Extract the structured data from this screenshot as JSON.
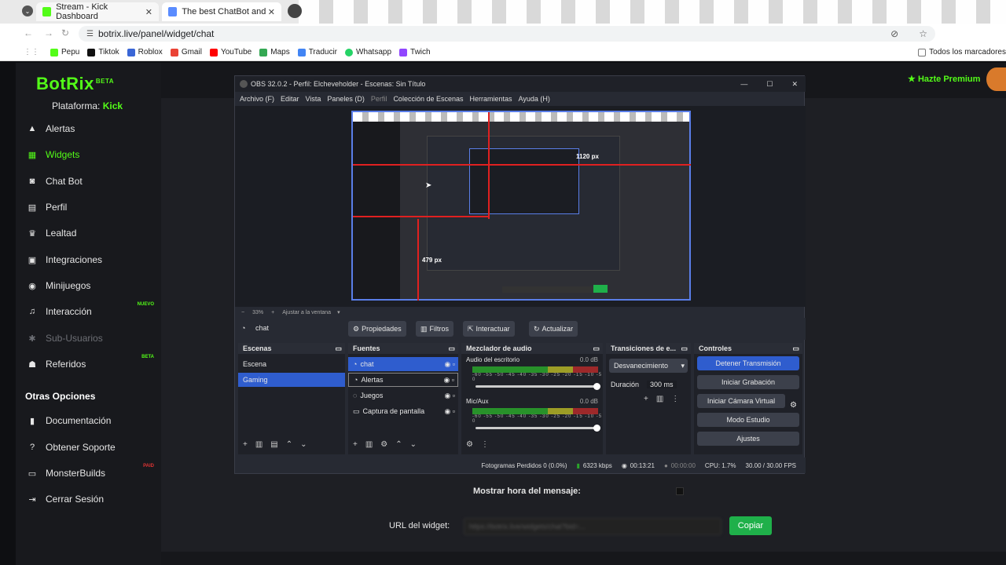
{
  "browser": {
    "tabs": [
      {
        "label": "Stream - Kick Dashboard",
        "color": "#53fc18"
      },
      {
        "label": "The best ChatBot and Widgets",
        "color": "#5a8cff"
      }
    ],
    "url": "botrix.live/panel/widget/chat",
    "bookmarks": [
      "Pepu",
      "Tiktok",
      "Roblox",
      "Gmail",
      "YouTube",
      "Maps",
      "Traducir",
      "Whatsapp",
      "Twich"
    ],
    "bookmarks_right": "Todos los marcadores"
  },
  "app": {
    "logo": "BotRix",
    "logo_badge": "BETA",
    "platform_label": "Plataforma:",
    "platform_value": "Kick",
    "premium": "Hazte Premium",
    "accent": "#53fc18"
  },
  "sidebar": {
    "items": [
      {
        "label": "Alertas",
        "icon": "warning-icon"
      },
      {
        "label": "Widgets",
        "icon": "grid-icon",
        "active": true
      },
      {
        "label": "Chat Bot",
        "icon": "robot-icon"
      },
      {
        "label": "Perfil",
        "icon": "id-card-icon"
      },
      {
        "label": "Lealtad",
        "icon": "trophy-icon"
      },
      {
        "label": "Integraciones",
        "icon": "plug-icon"
      },
      {
        "label": "Minijuegos",
        "icon": "gamepad-icon"
      },
      {
        "label": "Interacción",
        "icon": "music-icon",
        "badge": "NUEVO"
      },
      {
        "label": "Sub-Usuarios",
        "icon": "users-icon",
        "disabled": true
      },
      {
        "label": "Referidos",
        "icon": "referral-icon",
        "badge": "BETA"
      }
    ],
    "other_heading": "Otras Opciones",
    "other_items": [
      {
        "label": "Documentación",
        "icon": "book-icon"
      },
      {
        "label": "Obtener Soporte",
        "icon": "question-icon"
      },
      {
        "label": "MonsterBuilds",
        "icon": "laptop-icon",
        "badge": "PAID"
      },
      {
        "label": "Cerrar Sesión",
        "icon": "logout-icon"
      }
    ]
  },
  "obs": {
    "title": "OBS 32.0.2 - Perfil: Elcheveholder - Escenas: Sin Título",
    "menu": [
      "Archivo (F)",
      "Editar",
      "Vista",
      "Paneles (D)",
      "Perfil",
      "Colección de Escenas",
      "Herramientas",
      "Ayuda (H)"
    ],
    "preview_overlay": {
      "width_label": "1120 px",
      "height_label": "479 px"
    },
    "zoom": "33%",
    "fit_label": "Ajustar a la ventana",
    "selected_source": "chat",
    "source_buttons": [
      "Propiedades",
      "Filtros",
      "Interactuar",
      "Actualizar"
    ],
    "scenes": {
      "title": "Escenas",
      "items": [
        "Escena",
        "Gaming"
      ]
    },
    "sources": {
      "title": "Fuentes",
      "items": [
        "chat",
        "Alertas",
        "Juegos",
        "Captura de pantalla"
      ]
    },
    "mixer": {
      "title": "Mezclador de audio",
      "channels": [
        {
          "name": "Audio del escritorio",
          "db": "0.0 dB"
        },
        {
          "name": "Mic/Aux",
          "db": "0.0 dB"
        }
      ],
      "ticks": "-60 -55 -50 -45 -40 -35 -30 -25 -20 -15 -10 -5 0"
    },
    "transitions": {
      "title": "Transiciones de e...",
      "type": "Desvanecimiento",
      "duration_label": "Duración",
      "duration": "300 ms"
    },
    "controls": {
      "title": "Controles",
      "buttons": [
        "Detener Transmisión",
        "Iniciar Grabación",
        "Iniciar Cámara Virtual",
        "Modo Estudio",
        "Ajustes"
      ]
    },
    "status": {
      "dropped": "Fotogramas Perdidos 0 (0.0%)",
      "bitrate": "6323 kbps",
      "live_time": "00:13:21",
      "rec_time": "00:00:00",
      "cpu": "CPU: 1.7%",
      "fps": "30.00 / 30.00 FPS"
    }
  },
  "form": {
    "show_time_label": "Mostrar hora del mensaje:",
    "url_label": "URL del widget:",
    "url_value": "https://botrix.live/widgets/chat?bid=...",
    "copy_button": "Copiar"
  }
}
